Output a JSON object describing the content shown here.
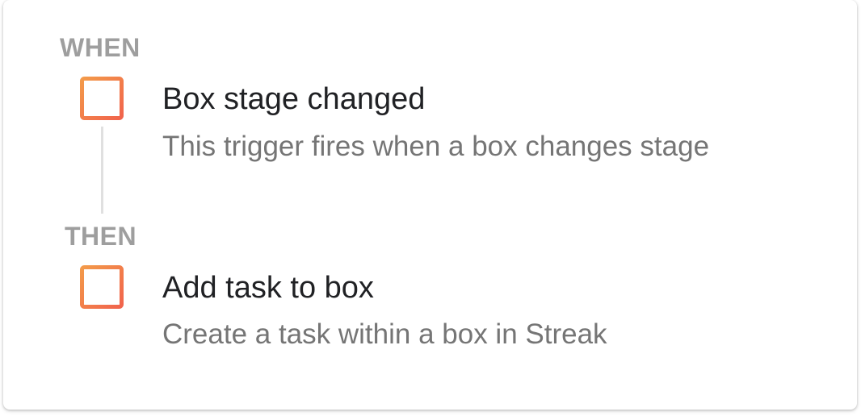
{
  "when_label": "WHEN",
  "then_label": "THEN",
  "trigger": {
    "title": "Box stage changed",
    "description": "This trigger fires when a box changes stage",
    "icon": "box-icon"
  },
  "action": {
    "title": "Add task to box",
    "description": "Create a task within a box in Streak",
    "icon": "box-icon"
  },
  "colors": {
    "icon_gradient_start": "#f08a45",
    "icon_gradient_end": "#f26a4b",
    "label_gray": "#9e9e9e",
    "title_dark": "#202124",
    "desc_gray": "#757575",
    "connector": "#e0e0e0"
  }
}
